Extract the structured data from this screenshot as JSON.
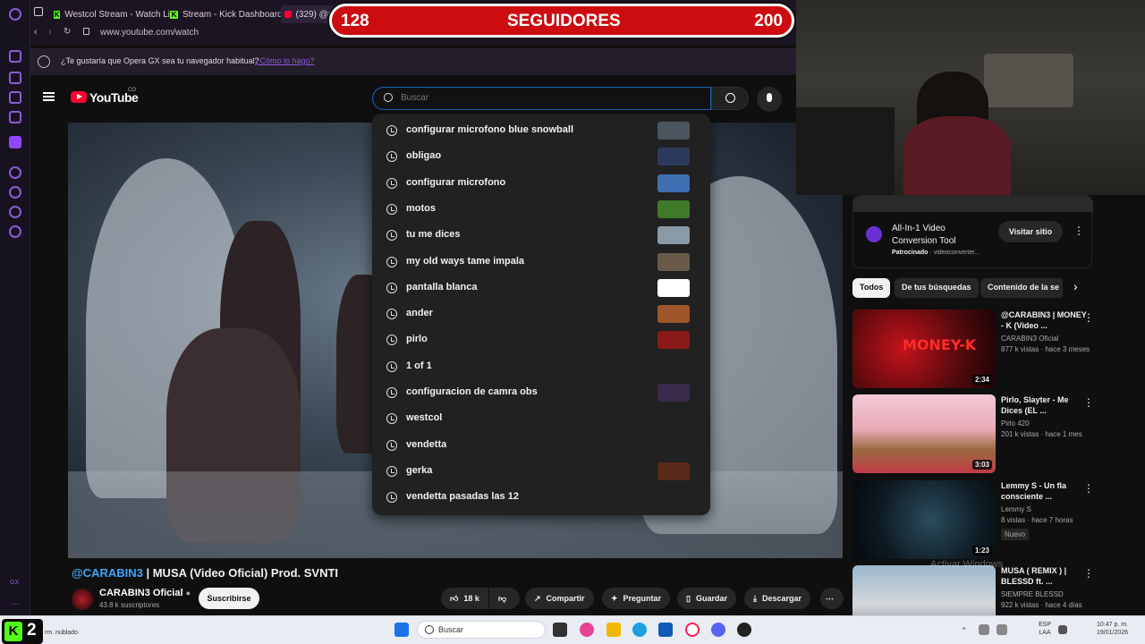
{
  "browser": {
    "tabs": [
      "Westcol Stream - Watch Li",
      "Stream - Kick Dashboard",
      "(329) @C"
    ],
    "url": "www.youtube.com/watch",
    "opera_prompt": "¿Te gustaría que Opera GX sea tu navegador habitual?",
    "opera_prompt_link": "¿Cómo lo hago?"
  },
  "follower_goal": {
    "current": "128",
    "label": "SEGUIDORES",
    "target": "200"
  },
  "youtube": {
    "logo": "YouTube",
    "country": "CO",
    "search": {
      "placeholder": "Buscar"
    },
    "suggestions": [
      {
        "text": "configurar microfono blue snowball",
        "thumb": "#4a5560"
      },
      {
        "text": "obligao",
        "thumb": "#2c3a5c"
      },
      {
        "text": "configurar microfono",
        "thumb": "#3f6fb0"
      },
      {
        "text": "motos",
        "thumb": "#3f7a2a"
      },
      {
        "text": "tu me dices",
        "thumb": "#8a9aa6"
      },
      {
        "text": "my old ways tame impala",
        "thumb": "#6a5a4a"
      },
      {
        "text": "pantalla blanca",
        "thumb": "#ffffff"
      },
      {
        "text": "ander",
        "thumb": "#a0552a"
      },
      {
        "text": "pirlo",
        "thumb": "#8a1a1a"
      },
      {
        "text": "1 of 1",
        "thumb": ""
      },
      {
        "text": "configuracion de camra obs",
        "thumb": "#3a2a4a"
      },
      {
        "text": "westcol",
        "thumb": ""
      },
      {
        "text": "vendetta",
        "thumb": ""
      },
      {
        "text": "gerka",
        "thumb": "#5a2a1a"
      },
      {
        "text": "vendetta pasadas las 12",
        "thumb": ""
      }
    ],
    "video": {
      "title_tag": "@CARABIN3",
      "title": " | MUSA (Video Oficial) Prod. SVNTI",
      "channel": "CARABIN3 Oficial",
      "subscribers": "43.8 k suscriptores",
      "subscribe": "Suscribirse",
      "likes": "18 k",
      "share": "Compartir",
      "ask": "Preguntar",
      "save": "Guardar",
      "download": "Descargar"
    },
    "ad": {
      "title": "All-In-1 Video Conversion Tool",
      "sponsored": "Patrocinado",
      "domain": "videoconverter...",
      "cta": "Visitar sitio"
    },
    "chips": [
      "Todos",
      "De tus búsquedas",
      "Contenido de la se"
    ],
    "recommended": [
      {
        "title": "@CARABIN3 | MONEY - K (Video ...",
        "channel": "CARABIN3 Oficial",
        "meta": "877 k vistas · hace 3 meses",
        "duration": "2:34",
        "badge": "",
        "thumb_text": "MONEY-K"
      },
      {
        "title": "Pirlo, Slayter - Me Dices (EL ...",
        "channel": "Pirlo 420",
        "meta": "201 k vistas · hace 1 mes",
        "duration": "3:03",
        "badge": "",
        "thumb_text": ""
      },
      {
        "title": "Lemmy S - Un fla consciente ...",
        "channel": "Lemmy S",
        "meta": "8 vistas · hace 7 horas",
        "duration": "1:23",
        "badge": "Nuevo",
        "thumb_text": ""
      },
      {
        "title": "MUSA ( REMIX ) | BLESSD ft. ...",
        "channel": "SIEMPRE BLESSD",
        "meta": "922 k vistas · hace 4 días",
        "duration": "",
        "badge": "",
        "thumb_text": ""
      }
    ]
  },
  "watermark": "Activar Windows",
  "taskbar": {
    "search": "Buscar",
    "kick_count": "2",
    "status_text": "rm. nublado",
    "lang": "ESP",
    "lang2": "LAA",
    "time": "10:47 p. m.",
    "date": "19/01/2026"
  }
}
